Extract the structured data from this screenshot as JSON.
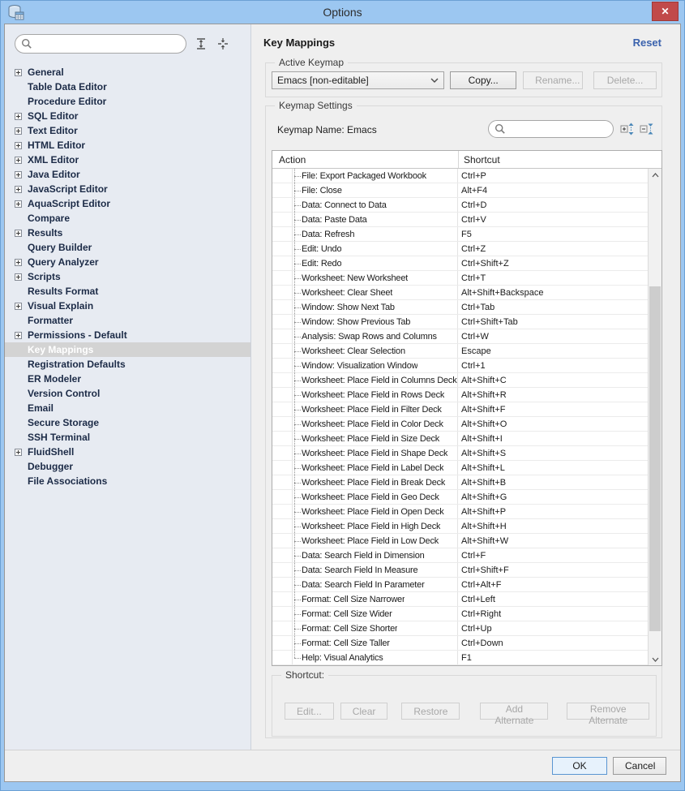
{
  "window": {
    "title": "Options",
    "close_label": "✕"
  },
  "colors": {
    "titlebar_blue": "#9cc7f1",
    "close_red": "#c14a4a",
    "reset_blue": "#3a62ad",
    "sidebar_bg": "#e7ebf2",
    "panel_bg": "#efefef",
    "selected_item_bg": "#d3d3d3"
  },
  "sidebar": {
    "search": {
      "value": "",
      "placeholder": ""
    },
    "items": [
      {
        "label": "General",
        "expandable": true,
        "selected": false
      },
      {
        "label": "Table Data Editor",
        "expandable": false,
        "selected": false
      },
      {
        "label": "Procedure Editor",
        "expandable": false,
        "selected": false
      },
      {
        "label": "SQL Editor",
        "expandable": true,
        "selected": false
      },
      {
        "label": "Text Editor",
        "expandable": true,
        "selected": false
      },
      {
        "label": "HTML Editor",
        "expandable": true,
        "selected": false
      },
      {
        "label": "XML Editor",
        "expandable": true,
        "selected": false
      },
      {
        "label": "Java Editor",
        "expandable": true,
        "selected": false
      },
      {
        "label": "JavaScript Editor",
        "expandable": true,
        "selected": false
      },
      {
        "label": "AquaScript Editor",
        "expandable": true,
        "selected": false
      },
      {
        "label": "Compare",
        "expandable": false,
        "selected": false
      },
      {
        "label": "Results",
        "expandable": true,
        "selected": false
      },
      {
        "label": "Query Builder",
        "expandable": false,
        "selected": false
      },
      {
        "label": "Query Analyzer",
        "expandable": true,
        "selected": false
      },
      {
        "label": "Scripts",
        "expandable": true,
        "selected": false
      },
      {
        "label": "Results Format",
        "expandable": false,
        "selected": false
      },
      {
        "label": "Visual Explain",
        "expandable": true,
        "selected": false
      },
      {
        "label": "Formatter",
        "expandable": false,
        "selected": false
      },
      {
        "label": "Permissions - Default",
        "expandable": true,
        "selected": false
      },
      {
        "label": "Key Mappings",
        "expandable": false,
        "selected": true
      },
      {
        "label": "Registration Defaults",
        "expandable": false,
        "selected": false
      },
      {
        "label": "ER Modeler",
        "expandable": false,
        "selected": false
      },
      {
        "label": "Version Control",
        "expandable": false,
        "selected": false
      },
      {
        "label": "Email",
        "expandable": false,
        "selected": false
      },
      {
        "label": "Secure Storage",
        "expandable": false,
        "selected": false
      },
      {
        "label": "SSH Terminal",
        "expandable": false,
        "selected": false
      },
      {
        "label": "FluidShell",
        "expandable": true,
        "selected": false
      },
      {
        "label": "Debugger",
        "expandable": false,
        "selected": false
      },
      {
        "label": "File Associations",
        "expandable": false,
        "selected": false
      }
    ]
  },
  "header": {
    "title": "Key Mappings",
    "reset_label": "Reset"
  },
  "active_keymap": {
    "legend": "Active Keymap",
    "selected_value": "Emacs [non-editable]",
    "copy_label": "Copy...",
    "rename_label": "Rename...",
    "delete_label": "Delete..."
  },
  "keymap_settings": {
    "legend": "Keymap Settings",
    "keymap_name_label": "Keymap Name:",
    "keymap_name_value": "Emacs",
    "search": {
      "value": "",
      "placeholder": ""
    },
    "table": {
      "columns": [
        "Action",
        "Shortcut"
      ],
      "rows": [
        {
          "action": "File: Export Packaged Workbook",
          "shortcut": "Ctrl+P"
        },
        {
          "action": "File: Close",
          "shortcut": "Alt+F4"
        },
        {
          "action": "Data: Connect to Data",
          "shortcut": "Ctrl+D"
        },
        {
          "action": "Data: Paste Data",
          "shortcut": "Ctrl+V"
        },
        {
          "action": "Data: Refresh",
          "shortcut": "F5"
        },
        {
          "action": "Edit: Undo",
          "shortcut": "Ctrl+Z"
        },
        {
          "action": "Edit: Redo",
          "shortcut": "Ctrl+Shift+Z"
        },
        {
          "action": "Worksheet: New Worksheet",
          "shortcut": "Ctrl+T"
        },
        {
          "action": "Worksheet: Clear Sheet",
          "shortcut": "Alt+Shift+Backspace"
        },
        {
          "action": "Window: Show Next Tab",
          "shortcut": "Ctrl+Tab"
        },
        {
          "action": "Window: Show Previous Tab",
          "shortcut": "Ctrl+Shift+Tab"
        },
        {
          "action": "Analysis: Swap Rows and Columns",
          "shortcut": "Ctrl+W"
        },
        {
          "action": "Worksheet: Clear Selection",
          "shortcut": "Escape"
        },
        {
          "action": "Window: Visualization Window",
          "shortcut": "Ctrl+1"
        },
        {
          "action": "Worksheet: Place Field in Columns Deck",
          "shortcut": "Alt+Shift+C"
        },
        {
          "action": "Worksheet: Place Field in Rows Deck",
          "shortcut": "Alt+Shift+R"
        },
        {
          "action": "Worksheet: Place Field in Filter Deck",
          "shortcut": "Alt+Shift+F"
        },
        {
          "action": "Worksheet: Place Field in Color Deck",
          "shortcut": "Alt+Shift+O"
        },
        {
          "action": "Worksheet: Place Field in Size Deck",
          "shortcut": "Alt+Shift+I"
        },
        {
          "action": "Worksheet: Place Field in Shape Deck",
          "shortcut": "Alt+Shift+S"
        },
        {
          "action": "Worksheet: Place Field in Label Deck",
          "shortcut": "Alt+Shift+L"
        },
        {
          "action": "Worksheet: Place Field in Break Deck",
          "shortcut": "Alt+Shift+B"
        },
        {
          "action": "Worksheet: Place Field in Geo Deck",
          "shortcut": "Alt+Shift+G"
        },
        {
          "action": "Worksheet: Place Field in Open Deck",
          "shortcut": "Alt+Shift+P"
        },
        {
          "action": "Worksheet: Place Field in High Deck",
          "shortcut": "Alt+Shift+H"
        },
        {
          "action": "Worksheet: Place Field in Low Deck",
          "shortcut": "Alt+Shift+W"
        },
        {
          "action": "Data: Search Field in Dimension",
          "shortcut": "Ctrl+F"
        },
        {
          "action": "Data: Search Field In Measure",
          "shortcut": "Ctrl+Shift+F"
        },
        {
          "action": "Data: Search Field In Parameter",
          "shortcut": "Ctrl+Alt+F"
        },
        {
          "action": "Format: Cell Size Narrower",
          "shortcut": "Ctrl+Left"
        },
        {
          "action": "Format: Cell Size Wider",
          "shortcut": "Ctrl+Right"
        },
        {
          "action": "Format: Cell Size Shorter",
          "shortcut": "Ctrl+Up"
        },
        {
          "action": "Format: Cell Size Taller",
          "shortcut": "Ctrl+Down"
        },
        {
          "action": "Help: Visual Analytics",
          "shortcut": "F1"
        }
      ]
    }
  },
  "shortcut_box": {
    "legend": "Shortcut:",
    "buttons": [
      {
        "name": "edit-button",
        "label": "Edit...",
        "enabled": false
      },
      {
        "name": "clear-button",
        "label": "Clear",
        "enabled": false
      },
      {
        "name": "restore-button",
        "label": "Restore",
        "enabled": false
      },
      {
        "name": "add-alternate-button",
        "label": "Add Alternate",
        "enabled": false
      },
      {
        "name": "remove-alternate-button",
        "label": "Remove Alternate",
        "enabled": false
      }
    ]
  },
  "footer": {
    "ok_label": "OK",
    "cancel_label": "Cancel"
  }
}
